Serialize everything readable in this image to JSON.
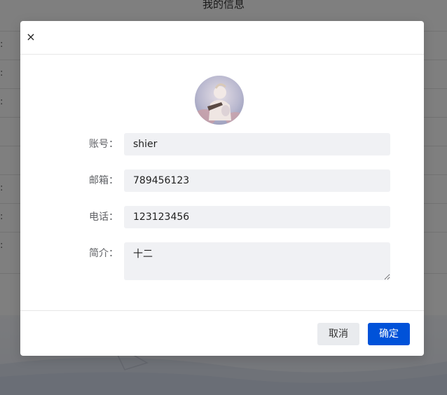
{
  "background": {
    "title": "我的信息",
    "colons": [
      ":",
      ":",
      ":",
      ":",
      ":",
      ":"
    ]
  },
  "dialog": {
    "close_symbol": "×",
    "avatar_icon": "user-avatar-image",
    "fields": {
      "account": {
        "label": "账号：",
        "value": "shier"
      },
      "email": {
        "label": "邮箱：",
        "value": "789456123"
      },
      "phone": {
        "label": "电话：",
        "value": "123123456"
      },
      "intro": {
        "label": "简介：",
        "value": "十二"
      }
    },
    "cancel_label": "取消",
    "confirm_label": "确定"
  },
  "colors": {
    "primary": "#0052d9",
    "input_bg": "#f0f1f4",
    "overlay": "rgba(0,0,0,0.5)"
  }
}
